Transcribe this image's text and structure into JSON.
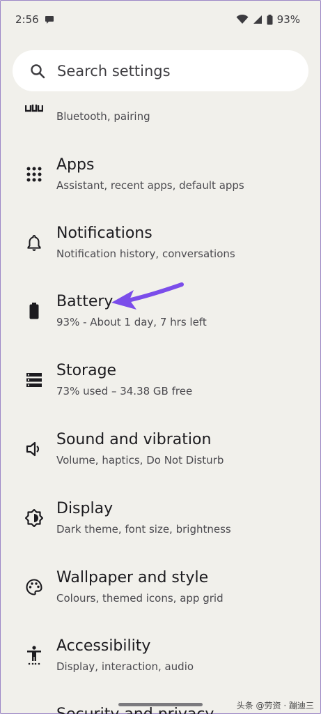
{
  "status_bar": {
    "time": "2:56",
    "battery": "93%"
  },
  "search": {
    "placeholder": "Search settings",
    "icon": "search-icon"
  },
  "settings": [
    {
      "id": "connected-devices",
      "icon": "devices-icon",
      "subtitle": "Bluetooth, pairing"
    },
    {
      "id": "apps",
      "icon": "apps-grid-icon",
      "title": "Apps",
      "subtitle": "Assistant, recent apps, default apps"
    },
    {
      "id": "notifications",
      "icon": "bell-icon",
      "title": "Notifications",
      "subtitle": "Notification history, conversations"
    },
    {
      "id": "battery",
      "icon": "battery-icon",
      "title": "Battery",
      "subtitle": "93% - About 1 day, 7 hrs left"
    },
    {
      "id": "storage",
      "icon": "storage-icon",
      "title": "Storage",
      "subtitle": "73% used – 34.38 GB free"
    },
    {
      "id": "sound",
      "icon": "speaker-icon",
      "title": "Sound and vibration",
      "subtitle": "Volume, haptics, Do Not Disturb"
    },
    {
      "id": "display",
      "icon": "brightness-icon",
      "title": "Display",
      "subtitle": "Dark theme, font size, brightness"
    },
    {
      "id": "wallpaper",
      "icon": "palette-icon",
      "title": "Wallpaper and style",
      "subtitle": "Colours, themed icons, app grid"
    },
    {
      "id": "accessibility",
      "icon": "accessibility-icon",
      "title": "Accessibility",
      "subtitle": "Display, interaction, audio"
    },
    {
      "id": "security",
      "title": "Security and privacy"
    }
  ],
  "annotation": {
    "icon": "purple-arrow-icon",
    "color": "#7b4dea"
  },
  "watermark": "头条 @劳资 · 蹦迪三"
}
